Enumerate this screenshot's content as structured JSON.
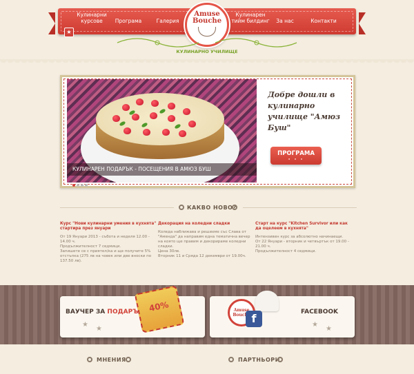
{
  "header": {
    "nav_left": [
      "Кулинарни\nкурсове",
      "Програма",
      "Галерия"
    ],
    "nav_right": [
      "Кулинарен\nтийм билдинг",
      "За нас",
      "Контакти"
    ],
    "logo": {
      "line1": "Amuse",
      "line2": "Bouche"
    },
    "bookmark_icon": "bookmark-icon"
  },
  "school_label": "КУЛИНАРНО УЧИЛИЩЕ",
  "hero": {
    "caption": "КУЛИНАРЕН ПОДАРЪК - ПОСЕЩЕНИЯ В АМЮЗ БУШ",
    "welcome": "Добре дошли в кулинарно училище \"Амюз Буш\"",
    "cta_label": "ПРОГРАМА",
    "cta_dots": "• • •"
  },
  "news_section": {
    "title": "КАКВО НОВО?",
    "items": [
      {
        "title": "Курс \"Нови кулинарни умения в кухнята\" стартира през януари",
        "lines": [
          "От 19 Януари 2013 - събота и неделя 12.00 - 14.00 ч.",
          "Продължителност 7 седмици.",
          "Запишете се с приятел/ка и ще получите 5% отстъпка (275 лв на човек или две вноски по 137.50 лв)."
        ]
      },
      {
        "title": "Декорация на коледни сладки",
        "lines": [
          "Коледа наближава и решихме със Слава от \"Аменда\" да направим една тематична вечер на която ще правим и декорираме коледни сладки.",
          "Цена 30лв.",
          "Вторник 11 и Сряда 12 декември от 19.00ч."
        ]
      },
      {
        "title": "Старт на курс \"Kitchen Survivor или как да оцелеем в кухнята\"",
        "lines": [
          "Интензивен курс за абсолютно начинаещи.",
          "От 22 Януари - вторник и четвъртък от 19.00 - 21.00 ч.",
          "Продължителност 4 седмици."
        ]
      }
    ]
  },
  "voucher": {
    "prefix": "ВАУЧЕР ЗА ",
    "highlight": "ПОДАРЪК",
    "badge": "40%"
  },
  "facebook": {
    "label": "FACEBOOK",
    "icon": "f",
    "badge_line1": "Amuse",
    "badge_line2": "Bouche"
  },
  "bottom": {
    "opinions": "МНЕНИЯ",
    "partners": "ПАРТНЬОРИ"
  },
  "colors": {
    "accent": "#d2433a",
    "green": "#7aa229",
    "fb": "#3b5998",
    "bg": "#f4ede0"
  }
}
